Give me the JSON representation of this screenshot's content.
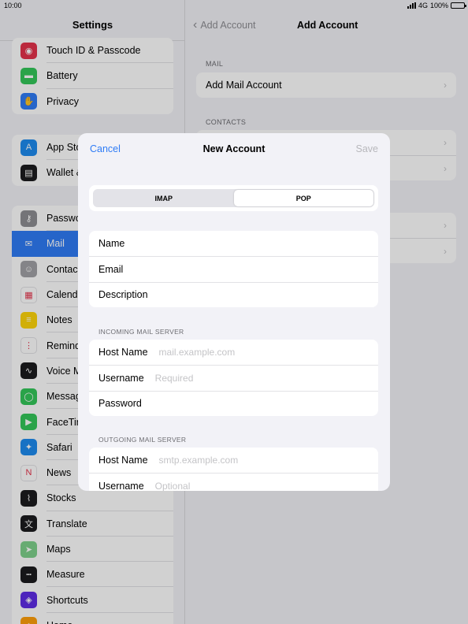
{
  "status": {
    "time": "10:00",
    "network": "4G",
    "battery": "100%"
  },
  "sidebar": {
    "title": "Settings",
    "groups": [
      [
        {
          "label": "Touch ID & Passcode",
          "icon": "fingerprint-icon",
          "color": "#e5334b",
          "glyph": "◉"
        },
        {
          "label": "Battery",
          "icon": "battery-icon",
          "color": "#34c759",
          "glyph": "▬"
        },
        {
          "label": "Privacy",
          "icon": "hand-icon",
          "color": "#2f7cf6",
          "glyph": "✋"
        }
      ],
      [
        {
          "label": "App Sto",
          "icon": "app-store-icon",
          "color": "#1e8cf0",
          "glyph": "A"
        },
        {
          "label": "Wallet &",
          "icon": "wallet-icon",
          "color": "#1c1c1e",
          "glyph": "▤"
        }
      ],
      [
        {
          "label": "Passwo",
          "icon": "key-icon",
          "color": "#8e8e93",
          "glyph": "⚷"
        },
        {
          "label": "Mail",
          "icon": "mail-icon",
          "color": "#2f7cf6",
          "glyph": "✉",
          "active": true
        },
        {
          "label": "Contac",
          "icon": "contacts-icon",
          "color": "#a2a2a6",
          "glyph": "☺"
        },
        {
          "label": "Calenda",
          "icon": "calendar-icon",
          "color": "#ffffff",
          "glyph": "▦"
        },
        {
          "label": "Notes",
          "icon": "notes-icon",
          "color": "#ffd60a",
          "glyph": "≡"
        },
        {
          "label": "Remind",
          "icon": "reminders-icon",
          "color": "#ffffff",
          "glyph": "⋮"
        },
        {
          "label": "Voice M",
          "icon": "voice-memos-icon",
          "color": "#1c1c1e",
          "glyph": "∿"
        },
        {
          "label": "Messag",
          "icon": "messages-icon",
          "color": "#34c759",
          "glyph": "◯"
        },
        {
          "label": "FaceTin",
          "icon": "facetime-icon",
          "color": "#34c759",
          "glyph": "▶"
        },
        {
          "label": "Safari",
          "icon": "safari-icon",
          "color": "#1e8cf0",
          "glyph": "✦"
        },
        {
          "label": "News",
          "icon": "news-icon",
          "color": "#ffffff",
          "glyph": "N"
        },
        {
          "label": "Stocks",
          "icon": "stocks-icon",
          "color": "#1c1c1e",
          "glyph": "⌇"
        },
        {
          "label": "Translate",
          "icon": "translate-icon",
          "color": "#1c1c1e",
          "glyph": "文"
        },
        {
          "label": "Maps",
          "icon": "maps-icon",
          "color": "#7ed18b",
          "glyph": "➤"
        },
        {
          "label": "Measure",
          "icon": "measure-icon",
          "color": "#1c1c1e",
          "glyph": "┅"
        },
        {
          "label": "Shortcuts",
          "icon": "shortcuts-icon",
          "color": "#5e2de6",
          "glyph": "◈"
        },
        {
          "label": "Home",
          "icon": "home-icon",
          "color": "#ff9f0a",
          "glyph": "⌂"
        }
      ]
    ]
  },
  "detail": {
    "back_label": "Add Account",
    "title": "Add Account",
    "mail_header": "MAIL",
    "add_mail_account": "Add Mail Account",
    "contacts_header": "CONTACTS"
  },
  "modal": {
    "cancel": "Cancel",
    "title": "New Account",
    "save": "Save",
    "segments": [
      "IMAP",
      "POP"
    ],
    "selected_segment": "POP",
    "account_fields": [
      "Name",
      "Email",
      "Description"
    ],
    "incoming_header": "INCOMING MAIL SERVER",
    "incoming": [
      {
        "label": "Host Name",
        "placeholder": "mail.example.com"
      },
      {
        "label": "Username",
        "placeholder": "Required"
      },
      {
        "label": "Password",
        "placeholder": ""
      }
    ],
    "outgoing_header": "OUTGOING MAIL SERVER",
    "outgoing": [
      {
        "label": "Host Name",
        "placeholder": "smtp.example.com"
      },
      {
        "label": "Username",
        "placeholder": "Optional"
      }
    ]
  }
}
